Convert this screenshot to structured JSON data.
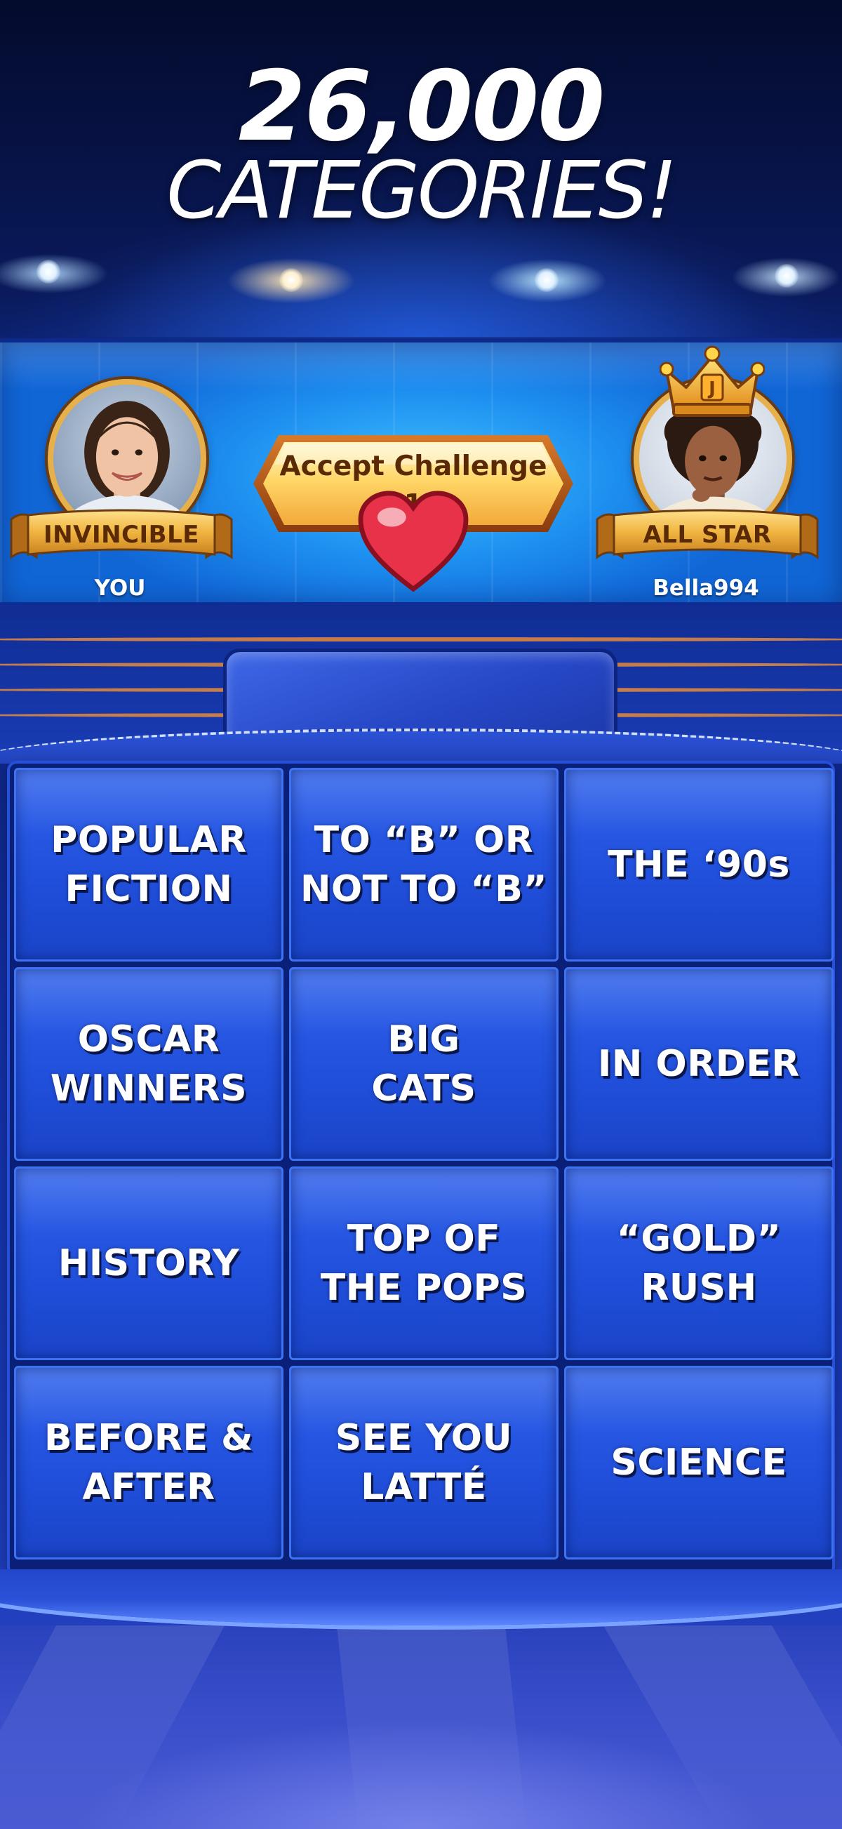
{
  "hero": {
    "line1": "26,000",
    "line2": "CATEGORIES!"
  },
  "challenge": {
    "you": {
      "rank": "INVINCIBLE",
      "name": "YOU"
    },
    "opponent": {
      "rank": "ALL STAR",
      "name": "Bella994",
      "crown_letter": "J"
    },
    "accept_button": {
      "label": "Accept Challenge",
      "lives": "1"
    }
  },
  "board": {
    "categories": [
      "POPULAR\nFICTION",
      "TO “B” OR\nNOT TO “B”",
      "THE ‘90s",
      "OSCAR\nWINNERS",
      "BIG\nCATS",
      "IN ORDER",
      "HISTORY",
      "TOP OF\nTHE POPS",
      "“GOLD”\nRUSH",
      "BEFORE &\nAFTER",
      "SEE YOU\nLATTÉ",
      "SCIENCE"
    ]
  },
  "colors": {
    "tile": "#2150dc",
    "gold": "#e8b04a",
    "banner": "#1d8ff0",
    "heart": "#e8324a"
  },
  "icons": {
    "lives": "heart-icon",
    "crown": "crown-icon"
  }
}
